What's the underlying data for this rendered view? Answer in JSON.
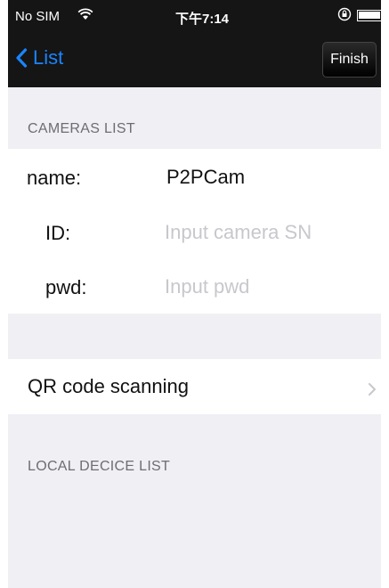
{
  "status_bar": {
    "carrier": "No SIM",
    "wifi_icon": "wifi-icon",
    "time": "下午7:14",
    "lock_icon": "orientation-lock-icon",
    "battery_icon": "battery-icon"
  },
  "nav": {
    "back_label": "List",
    "finish_label": "Finish"
  },
  "cameras": {
    "header": "CAMERAS LIST",
    "name_label": "name:",
    "name_value": "P2PCam",
    "id_label": "ID:",
    "id_placeholder": "Input camera SN",
    "pwd_label": "pwd:",
    "pwd_placeholder": "Input pwd"
  },
  "qr": {
    "label": "QR code scanning"
  },
  "local": {
    "header": "LOCAL DECICE LIST"
  },
  "colors": {
    "accent": "#1a84ff",
    "topbar": "#151515",
    "background": "#efeff4",
    "placeholder": "#c7c7cd"
  }
}
